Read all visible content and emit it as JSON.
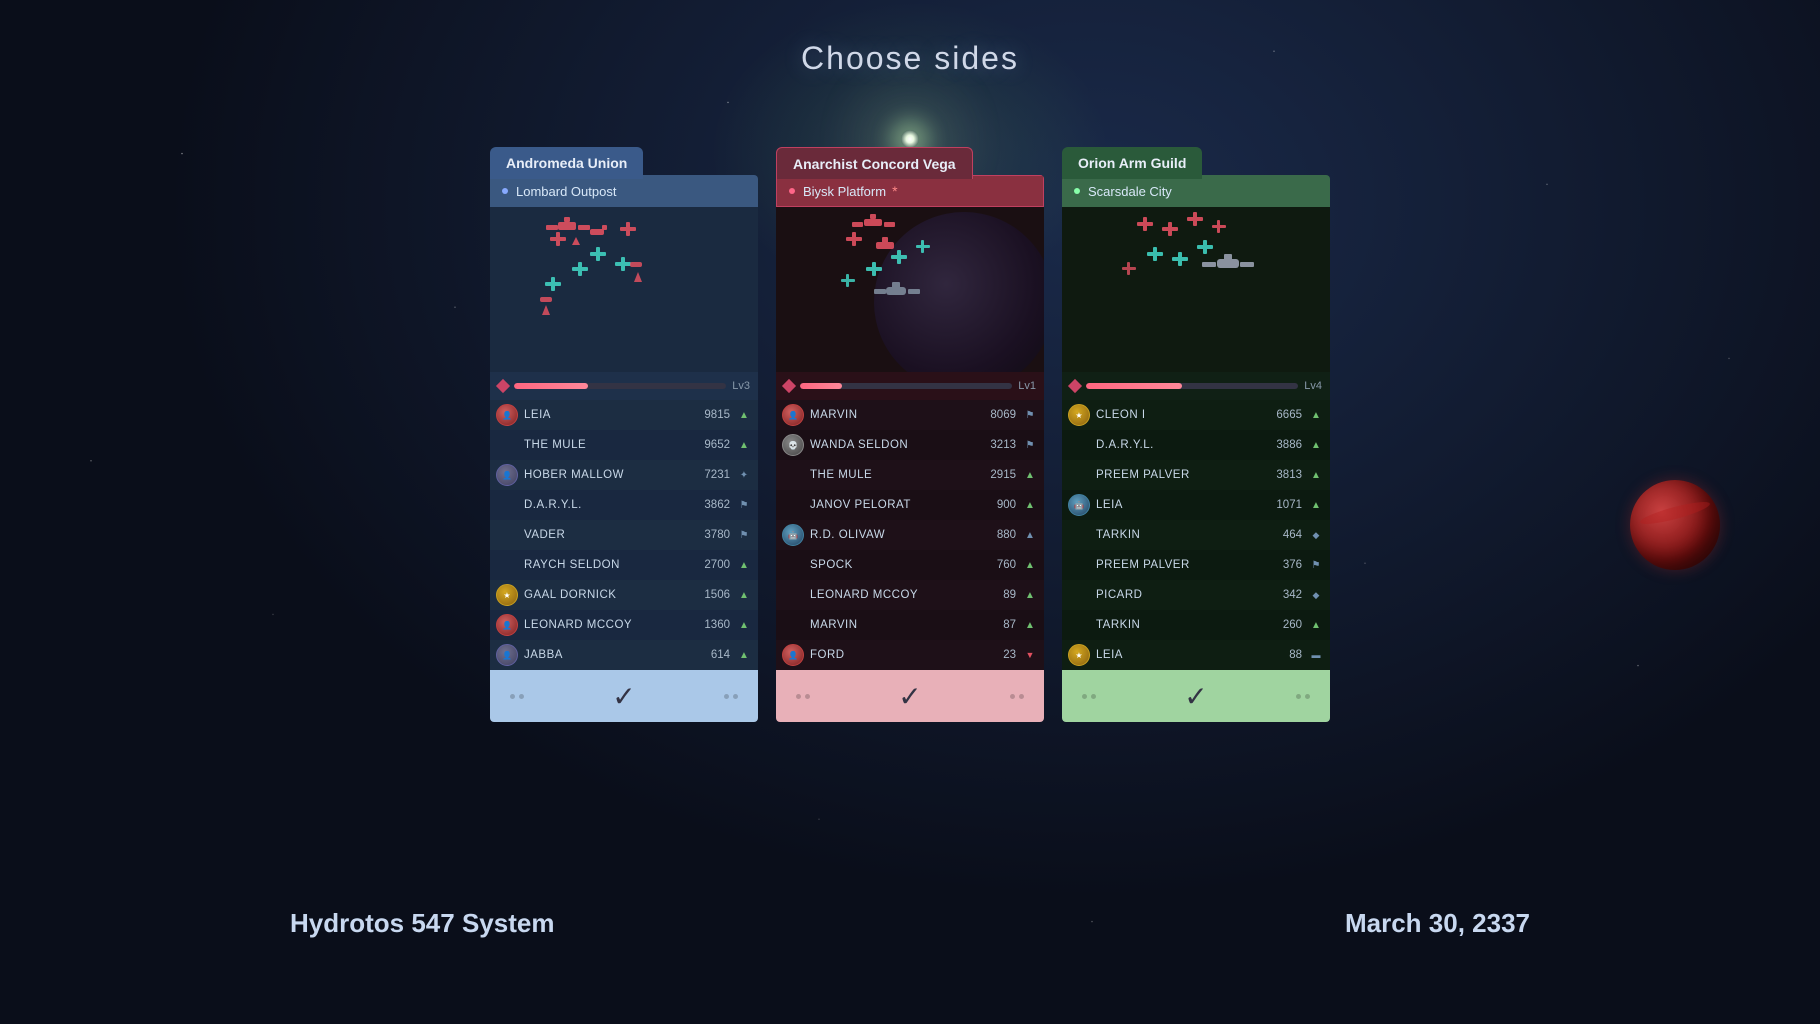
{
  "page": {
    "title": "Choose sides",
    "bottom_left": "Hydrotos 547 System",
    "bottom_right": "March 30, 2337"
  },
  "factions": [
    {
      "id": "andromeda",
      "name": "Andromeda Union",
      "location": "Lombard Outpost",
      "level": "Lv3",
      "bar_width": "35%",
      "tab_color": "blue",
      "roster": [
        {
          "name": "LEIA",
          "score": "9815",
          "avatar": "red",
          "icon": "▲"
        },
        {
          "name": "THE MULE",
          "score": "9652",
          "avatar": "none",
          "icon": "▲"
        },
        {
          "name": "HOBER MALLOW",
          "score": "7231",
          "avatar": "gray",
          "icon": "✦"
        },
        {
          "name": "D.A.R.Y.L.",
          "score": "3862",
          "avatar": "none",
          "icon": "⚑"
        },
        {
          "name": "VADER",
          "score": "3780",
          "avatar": "none",
          "icon": "⚑"
        },
        {
          "name": "RAYCH SELDON",
          "score": "2700",
          "avatar": "none",
          "icon": "▲"
        },
        {
          "name": "GAAL DORNICK",
          "score": "1506",
          "avatar": "gold",
          "icon": "▲"
        },
        {
          "name": "LEONARD MCCOY",
          "score": "1360",
          "avatar": "red",
          "icon": "▲"
        },
        {
          "name": "JABBA",
          "score": "614",
          "avatar": "gray",
          "icon": "▲"
        }
      ]
    },
    {
      "id": "anarchist",
      "name": "Anarchist Concord Vega",
      "location": "Biysk Platform",
      "level": "Lv1",
      "bar_width": "18%",
      "tab_color": "red",
      "roster": [
        {
          "name": "MARVIN",
          "score": "8069",
          "avatar": "red",
          "icon": "▲"
        },
        {
          "name": "WANDA SELDON",
          "score": "3213",
          "avatar": "skull",
          "icon": "▲"
        },
        {
          "name": "THE MULE",
          "score": "2915",
          "avatar": "none",
          "icon": "▲"
        },
        {
          "name": "JANOV PELORAT",
          "score": "900",
          "avatar": "none",
          "icon": "▲"
        },
        {
          "name": "R.D. OLIVAW",
          "score": "880",
          "avatar": "robot",
          "icon": "▲"
        },
        {
          "name": "SPOCK",
          "score": "760",
          "avatar": "none",
          "icon": "▲"
        },
        {
          "name": "LEONARD MCCOY",
          "score": "89",
          "avatar": "none",
          "icon": "▲"
        },
        {
          "name": "MARVIN",
          "score": "87",
          "avatar": "none",
          "icon": "▲"
        },
        {
          "name": "FORD",
          "score": "23",
          "avatar": "red2",
          "icon": "▼"
        }
      ]
    },
    {
      "id": "orion",
      "name": "Orion Arm Guild",
      "location": "Scarsdale City",
      "level": "Lv4",
      "bar_width": "48%",
      "tab_color": "green",
      "roster": [
        {
          "name": "CLEON I",
          "score": "6665",
          "avatar": "gold2",
          "icon": "▲"
        },
        {
          "name": "D.A.R.Y.L.",
          "score": "3886",
          "avatar": "none",
          "icon": "▲"
        },
        {
          "name": "PREEM PALVER",
          "score": "3813",
          "avatar": "none",
          "icon": "▲"
        },
        {
          "name": "LEIA",
          "score": "1071",
          "avatar": "robot2",
          "icon": "▲"
        },
        {
          "name": "TARKIN",
          "score": "464",
          "avatar": "none",
          "icon": "◆"
        },
        {
          "name": "PREEM PALVER",
          "score": "376",
          "avatar": "none",
          "icon": "⚑"
        },
        {
          "name": "PICARD",
          "score": "342",
          "avatar": "none",
          "icon": "◆"
        },
        {
          "name": "TARKIN",
          "score": "260",
          "avatar": "none",
          "icon": "▲"
        },
        {
          "name": "LEIA",
          "score": "88",
          "avatar": "gold3",
          "icon": "▬"
        }
      ]
    }
  ]
}
